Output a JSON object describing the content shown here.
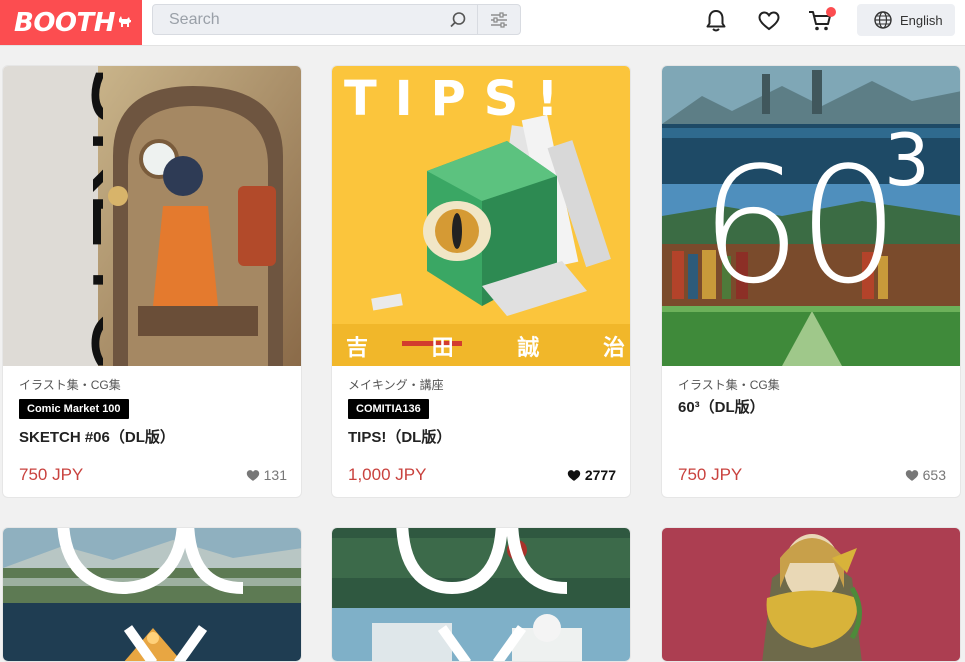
{
  "header": {
    "logo_text": "BOOTH",
    "search_placeholder": "Search",
    "language_label": "English"
  },
  "icons": {
    "logo_mark": "dog-icon",
    "search": "magnifier-icon",
    "filter": "sliders-icon",
    "notifications": "bell-icon",
    "favorites": "heart-icon",
    "cart": "cart-icon",
    "language": "globe-icon"
  },
  "colors": {
    "brand": "#fc4d50",
    "price": "#c9423e",
    "tag_bg": "#000000"
  },
  "products": [
    {
      "category": "イラスト集・CG集",
      "tag": "Comic Market 100",
      "title": "SKETCH #06（DL版）",
      "price": "750 JPY",
      "likes": "131",
      "cover_text": "SKETCH"
    },
    {
      "category": "メイキング・講座",
      "tag": "COMITIA136",
      "title": "TIPS!（DL版）",
      "price": "1,000 JPY",
      "likes": "2777",
      "cover_text": "TIPS!",
      "cover_author": "吉 田 誠 治"
    },
    {
      "category": "イラスト集・CG集",
      "tag": "",
      "title": "60³（DL版）",
      "price": "750 JPY",
      "likes": "653",
      "cover_text": "60",
      "cover_sup": "3"
    }
  ]
}
